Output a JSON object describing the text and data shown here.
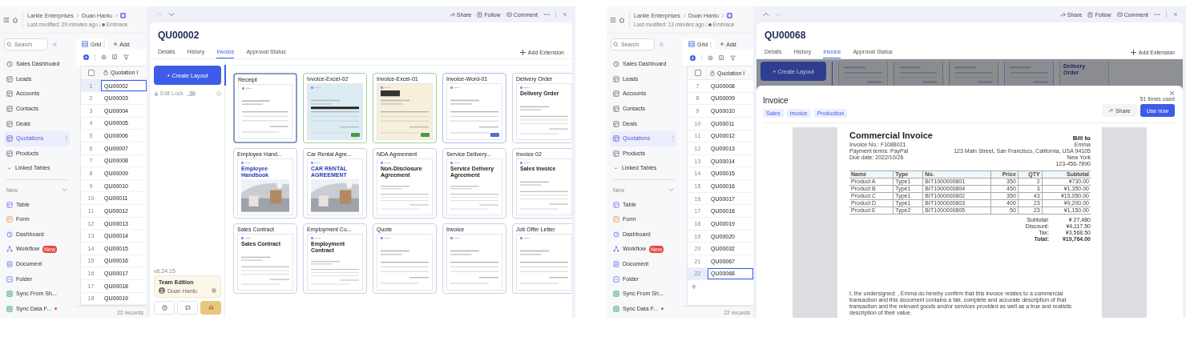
{
  "screens": [
    {
      "toolbar": {
        "breadcrumb": [
          "Larkie Enterprises",
          "Duan Hanlu"
        ],
        "last_modified": "Last modified: 29 minutes ago",
        "workspace": "Embrace"
      },
      "sidebar": {
        "search_placeholder": "Search",
        "nav": [
          {
            "label": "Sales Dashboard",
            "kind": "dashboard",
            "selected": false
          },
          {
            "label": "Leads",
            "kind": "table",
            "selected": false
          },
          {
            "label": "Accounts",
            "kind": "table",
            "selected": false
          },
          {
            "label": "Contacts",
            "kind": "table",
            "selected": false
          },
          {
            "label": "Deals",
            "kind": "table",
            "selected": false
          },
          {
            "label": "Quotations",
            "kind": "table",
            "selected": true
          },
          {
            "label": "Products",
            "kind": "table",
            "selected": false
          }
        ],
        "linked_tables": "Linked Tables",
        "new_label": "New",
        "new_items": [
          {
            "label": "Table",
            "kind": "table",
            "alert": false
          },
          {
            "label": "Form",
            "kind": "form",
            "alert": false
          },
          {
            "label": "Dashboard",
            "kind": "dashboard",
            "alert": false
          },
          {
            "label": "Workflow",
            "kind": "workflow",
            "badge": "New",
            "alert": false
          },
          {
            "label": "Document",
            "kind": "document",
            "alert": false
          },
          {
            "label": "Folder",
            "kind": "folder",
            "alert": false
          },
          {
            "label": "Sync From Sh...",
            "kind": "sheet",
            "alert": false
          },
          {
            "label": "Sync Data F...",
            "kind": "sync",
            "alert": true
          }
        ]
      },
      "grid": {
        "view": "Grid",
        "add": "Add",
        "column": "Quotation I",
        "all_checked": false,
        "add_row": false,
        "footer": "22 records",
        "rows": [
          {
            "number": "1",
            "id": "QU00002",
            "selected": true
          },
          {
            "number": "2",
            "id": "QU00003",
            "selected": false
          },
          {
            "number": "3",
            "id": "QU00004",
            "selected": false
          },
          {
            "number": "4",
            "id": "QU00005",
            "selected": false
          },
          {
            "number": "5",
            "id": "QU00006",
            "selected": false
          },
          {
            "number": "6",
            "id": "QU00007",
            "selected": false
          },
          {
            "number": "7",
            "id": "QU00008",
            "selected": false
          },
          {
            "number": "8",
            "id": "QU00009",
            "selected": false
          },
          {
            "number": "9",
            "id": "QU00010",
            "selected": false
          },
          {
            "number": "10",
            "id": "QU00011",
            "selected": false
          },
          {
            "number": "11",
            "id": "QU00012",
            "selected": false
          },
          {
            "number": "12",
            "id": "QU00013",
            "selected": false
          },
          {
            "number": "13",
            "id": "QU00014",
            "selected": false
          },
          {
            "number": "14",
            "id": "QU00015",
            "selected": false
          },
          {
            "number": "15",
            "id": "QU00016",
            "selected": false
          },
          {
            "number": "16",
            "id": "QU00017",
            "selected": false
          },
          {
            "number": "17",
            "id": "QU00018",
            "selected": false
          },
          {
            "number": "18",
            "id": "QU00019",
            "selected": false
          }
        ]
      },
      "record": {
        "previous_enabled": false,
        "next_enabled": true,
        "actions": [
          "Share",
          "Follow",
          "Comment"
        ],
        "title": "QU00002",
        "tabs": [
          {
            "label": "Details",
            "selected": false
          },
          {
            "label": "History",
            "selected": false
          },
          {
            "label": "Invoice",
            "selected": true
          },
          {
            "label": "Approval Status",
            "selected": false
          }
        ],
        "add_extension": "Add Extension",
        "layout_panel": {
          "create_layout": "+ Create Layout",
          "edit_lock": {
            "label": "Edit Lock",
            "on": false
          },
          "version": "v6.24.15",
          "edition": {
            "title": "Team Edition",
            "user": "Duan Hanlu"
          },
          "templates": [
            {
              "title": "Receipt",
              "kind": "doc",
              "selected": true,
              "preview": {
                "kind": "plain"
              }
            },
            {
              "title": "Ivvoice-Excel-02",
              "kind": "excel",
              "selected": false,
              "preview": {
                "kind": "blue"
              }
            },
            {
              "title": "Invoice-Excel-01",
              "kind": "excel",
              "selected": false,
              "preview": {
                "kind": "beige"
              }
            },
            {
              "title": "Invoice-Word-01",
              "kind": "word",
              "selected": false,
              "preview": {
                "kind": "plain"
              }
            },
            {
              "title": "Delivery Order",
              "kind": "doc",
              "selected": false,
              "preview": {
                "kind": "plain"
              },
              "heading": "Delivery Order"
            },
            {
              "title": "Employee Hand...",
              "kind": "doc",
              "selected": false,
              "heading": "Employee Handbook"
            },
            {
              "title": "Car Rental Agre...",
              "kind": "doc",
              "selected": false,
              "heading": "CAR RENTAL AGREEMENT"
            },
            {
              "title": "NDA Agreement",
              "kind": "doc",
              "selected": false,
              "preview": {
                "kind": "plain"
              },
              "heading": "Non-Disclosure Agreement"
            },
            {
              "title": "Service Delivery...",
              "kind": "doc",
              "selected": false,
              "preview": {
                "kind": "plain"
              },
              "heading": "Service Delivery Agreement"
            },
            {
              "title": "Invoice 02",
              "kind": "doc",
              "selected": false,
              "preview": {
                "kind": "plain"
              },
              "heading": "Sales Invoice"
            },
            {
              "title": "Sales Contract",
              "kind": "doc",
              "selected": false,
              "preview": {
                "kind": "plain"
              },
              "heading": "Sales Contract"
            },
            {
              "title": "Employment Co...",
              "kind": "doc",
              "selected": false,
              "preview": {
                "kind": "plain"
              },
              "heading": "Employment Contract"
            },
            {
              "title": "Quote",
              "kind": "doc",
              "selected": false,
              "preview": {
                "kind": "plain"
              }
            },
            {
              "title": "Invoice",
              "kind": "doc",
              "selected": false,
              "preview": {
                "kind": "plain"
              }
            },
            {
              "title": "Job Offer Letter",
              "kind": "doc",
              "selected": false,
              "preview": {
                "kind": "plain"
              }
            }
          ]
        }
      }
    },
    {
      "toolbar": {
        "breadcrumb": [
          "Larkie Enterprises",
          "Duan Hanlu"
        ],
        "last_modified": "Last modified: 13 minutes ago",
        "workspace": "Embrace"
      },
      "sidebar": {
        "search_placeholder": "Search",
        "nav": [
          {
            "label": "Sales Dashboard",
            "kind": "dashboard",
            "selected": false
          },
          {
            "label": "Leads",
            "kind": "table",
            "selected": false
          },
          {
            "label": "Accounts",
            "kind": "table",
            "selected": false
          },
          {
            "label": "Contacts",
            "kind": "table",
            "selected": false
          },
          {
            "label": "Deals",
            "kind": "table",
            "selected": false
          },
          {
            "label": "Quotations",
            "kind": "table",
            "selected": true
          },
          {
            "label": "Products",
            "kind": "table",
            "selected": false
          }
        ],
        "linked_tables": "Linked Tables",
        "new_label": "New",
        "new_items": [
          {
            "label": "Table",
            "kind": "table",
            "alert": false
          },
          {
            "label": "Form",
            "kind": "form",
            "alert": false
          },
          {
            "label": "Dashboard",
            "kind": "dashboard",
            "alert": false
          },
          {
            "label": "Workflow",
            "kind": "workflow",
            "badge": "New",
            "alert": false
          },
          {
            "label": "Document",
            "kind": "document",
            "alert": false
          },
          {
            "label": "Folder",
            "kind": "folder",
            "alert": false
          },
          {
            "label": "Sync From Sh...",
            "kind": "sheet",
            "alert": false
          },
          {
            "label": "Sync Data F...",
            "kind": "sync",
            "alert": true
          }
        ]
      },
      "grid": {
        "view": "Grid",
        "add": "Add",
        "column": "Quotation I",
        "all_checked": false,
        "add_row": true,
        "footer": "22 records",
        "rows": [
          {
            "number": "7",
            "id": "QU00008",
            "selected": false
          },
          {
            "number": "8",
            "id": "QU00009",
            "selected": false
          },
          {
            "number": "9",
            "id": "QU00010",
            "selected": false
          },
          {
            "number": "10",
            "id": "QU00011",
            "selected": false
          },
          {
            "number": "11",
            "id": "QU00012",
            "selected": false
          },
          {
            "number": "12",
            "id": "QU00013",
            "selected": false
          },
          {
            "number": "13",
            "id": "QU00014",
            "selected": false
          },
          {
            "number": "14",
            "id": "QU00015",
            "selected": false
          },
          {
            "number": "15",
            "id": "QU00016",
            "selected": false
          },
          {
            "number": "16",
            "id": "QU00017",
            "selected": false
          },
          {
            "number": "17",
            "id": "QU00018",
            "selected": false
          },
          {
            "number": "18",
            "id": "QU00019",
            "selected": false
          },
          {
            "number": "19",
            "id": "QU00020",
            "selected": false
          },
          {
            "number": "20",
            "id": "QU00032",
            "selected": false
          },
          {
            "number": "21",
            "id": "QU00067",
            "selected": false
          },
          {
            "number": "22",
            "id": "QU00068",
            "selected": true
          }
        ]
      },
      "record": {
        "previous_enabled": true,
        "next_enabled": false,
        "actions": [
          "Share",
          "Follow",
          "Comment"
        ],
        "title": "QU00068",
        "tabs": [
          {
            "label": "Details",
            "selected": false
          },
          {
            "label": "History",
            "selected": false
          },
          {
            "label": "Invoice",
            "selected": true
          },
          {
            "label": "Approval Status",
            "selected": false
          }
        ],
        "add_extension": "Add Extension",
        "backdrop": {
          "create_layout": "+ Create Layout",
          "cards": [
            {
              "kind": "doc"
            },
            {
              "kind": "excel"
            },
            {
              "kind": "excel"
            },
            {
              "kind": "word"
            },
            {
              "kind": "doc",
              "heading": "Delivery Order"
            }
          ]
        },
        "template_modal": {
          "title": "Invoice",
          "usage": "51 times used",
          "tags": [
            "Sales",
            "Invoice",
            "Production"
          ],
          "share": "Share",
          "use": "Use now",
          "document": {
            "title": "Commercial Invoice",
            "bill_to": "Bill to",
            "details": [
              "Invoice No.: F1088021",
              "Payment terms: PayPal",
              "Due date: 2022/10/26"
            ],
            "address": [
              "Emma",
              "123 Main Street, San Francisco, California, USA 94105",
              "New York",
              "123-456-7890"
            ],
            "columns": [
              "Name",
              "Type",
              "No.",
              "Price",
              "QTY",
              "Subtotal"
            ],
            "rows": [
              [
                "Product A",
                "Type1",
                "BIT1000000801",
                "350",
                "2",
                "¥730.00"
              ],
              [
                "Product B",
                "Type1",
                "BIT1000000804",
                "450",
                "3",
                "¥1,350.00"
              ],
              [
                "Product C",
                "Type1",
                "BIT1000000802",
                "350",
                "43",
                "¥15,050.00"
              ],
              [
                "Product D",
                "Type1",
                "BIT1000000803",
                "400",
                "23",
                "¥9,200.00"
              ],
              [
                "Product E",
                "Type2",
                "BIT1000000805",
                "50",
                "23",
                "¥1,150.00"
              ]
            ],
            "totals": [
              {
                "label": "Subtotal:",
                "value": "¥ 27,480",
                "bold": false
              },
              {
                "label": "Discount:",
                "value": "¥4,117.50",
                "bold": false
              },
              {
                "label": "Tax:",
                "value": "¥3,568.50",
                "bold": false
              },
              {
                "label": "Total:",
                "value": "¥19,764.00",
                "bold": true
              }
            ],
            "statement": "I, the undersigned: , Emma do hereby confirm that this invoice relates to a commercial transaction and this document contains a fair, complete and accurate description of that transaction and the relevant goods and/or services provided as well as a true and realistic description of their value."
          }
        }
      }
    }
  ]
}
